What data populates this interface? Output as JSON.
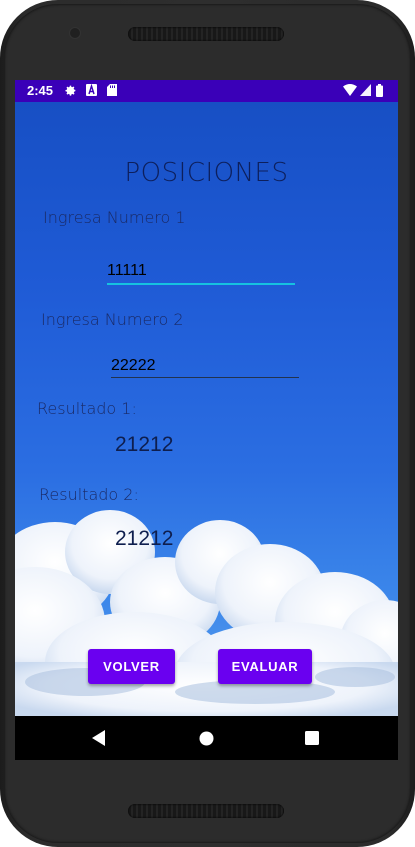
{
  "status_bar": {
    "time": "2:45",
    "icons": [
      "gear-icon",
      "font-a-icon",
      "sd-card-icon",
      "wifi-icon",
      "signal-icon",
      "battery-icon"
    ],
    "background": "#3a00b8"
  },
  "screen": {
    "title": "POSICIONES",
    "field1": {
      "label": "Ingresa Numero 1",
      "value": "11111"
    },
    "field2": {
      "label": "Ingresa Numero 2",
      "value": "22222"
    },
    "result1": {
      "label": "Resultado 1:",
      "value": "21212"
    },
    "result2": {
      "label": "Resultado 2:",
      "value": "21212"
    },
    "buttons": {
      "back": "VOLVER",
      "evaluate": "EVALUAR"
    },
    "accent": "#6a00f0",
    "field_focus_color": "#16c2e0"
  },
  "nav_bar": {
    "icons": [
      "back-icon",
      "home-icon",
      "recents-icon"
    ]
  }
}
